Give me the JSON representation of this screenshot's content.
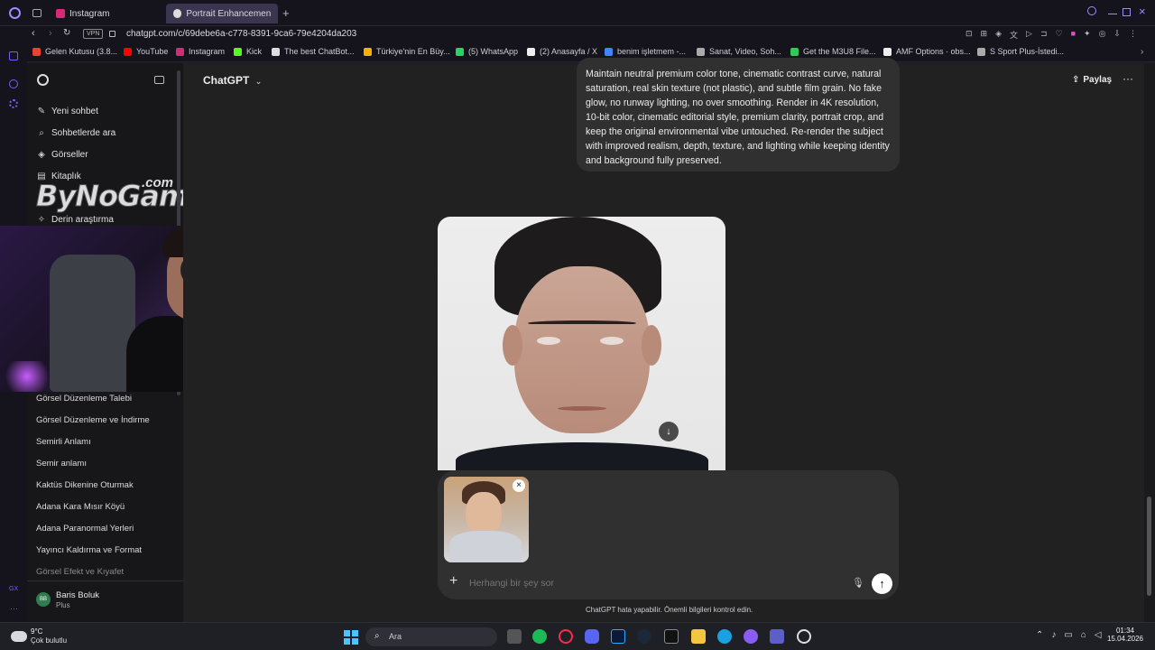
{
  "tabs": [
    {
      "label": "Instagram",
      "color": "#d62976"
    },
    {
      "label": "Portrait Enhancement Req",
      "color": "#8a8a8a"
    }
  ],
  "address": {
    "vpn": "VPN",
    "url": "chatgpt.com/c/69debe6a-c778-8391-9ca6-79e4204da203"
  },
  "bookmarks": [
    {
      "label": "Gelen Kutusu (3.8...",
      "color": "#ea4335"
    },
    {
      "label": "YouTube",
      "color": "#ff0000"
    },
    {
      "label": "Instagram",
      "color": "#d62976"
    },
    {
      "label": "Kick",
      "color": "#53fc18"
    },
    {
      "label": "The best ChatBot...",
      "color": "#dddddd"
    },
    {
      "label": "Türkiye'nin En Büy...",
      "color": "#f0b400"
    },
    {
      "label": "(5) WhatsApp",
      "color": "#25d366"
    },
    {
      "label": "(2) Anasayfa / X",
      "color": "#eeeeee"
    },
    {
      "label": "benim işletmem -...",
      "color": "#4285f4"
    },
    {
      "label": "Sanat, Video, Soh...",
      "color": "#aaaaaa"
    },
    {
      "label": "Get the M3U8 File...",
      "color": "#34c759"
    },
    {
      "label": "AMF Options · obs...",
      "color": "#eeeeee"
    },
    {
      "label": "S Sport Plus-İstedi...",
      "color": "#aaaaaa"
    }
  ],
  "sidebar": {
    "nav": [
      {
        "label": "Yeni sohbet",
        "icon": "edit-icon"
      },
      {
        "label": "Sohbetlerde ara",
        "icon": "search-icon"
      },
      {
        "label": "Görseller",
        "icon": "image-icon"
      },
      {
        "label": "Kitaplık",
        "icon": "library-icon"
      },
      {
        "label": "Derin araştırma",
        "icon": "telescope-icon"
      }
    ],
    "watermark": "ByNoGame",
    "watermark_suffix": ".com",
    "history": [
      "Görsel Düzenleme Talebi",
      "Görsel Düzenleme ve İndirme",
      "Semirli Anlamı",
      "Semir anlamı",
      "Kaktüs Dikenine Oturmak",
      "Adana Kara Mısır Köyü",
      "Adana Paranormal Yerleri",
      "Yayıncı Kaldırma ve Format",
      "Görsel Efekt ve Kıyafet"
    ],
    "user": {
      "initials": "BB",
      "name": "Baris Boluk",
      "plan": "Plus"
    }
  },
  "header": {
    "model": "ChatGPT",
    "share": "Paylaş"
  },
  "message": "Maintain neutral premium color tone, cinematic contrast curve, natural saturation, real skin texture (not plastic), and subtle film grain. No fake glow, no runway lighting, no over smoothing. Render in 4K resolution, 10-bit color, cinematic editorial style, premium clarity, portrait crop, and keep the original environmental vibe untouched. Re-render the subject with improved realism, depth, texture, and lighting while keeping identity and background fully preserved.",
  "composer": {
    "placeholder": "Herhangi bir şey sor"
  },
  "disclaimer": "ChatGPT hata yapabilir. Önemli bilgileri kontrol edin.",
  "taskbar": {
    "temp": "9°C",
    "weather": "Çok bulutlu",
    "search": "Ara",
    "time": "01:34",
    "date": "15.04.2026"
  },
  "colors": {
    "accent": "#7c5cff",
    "main_bg": "#212121",
    "sidebar_bg": "#17171a"
  }
}
